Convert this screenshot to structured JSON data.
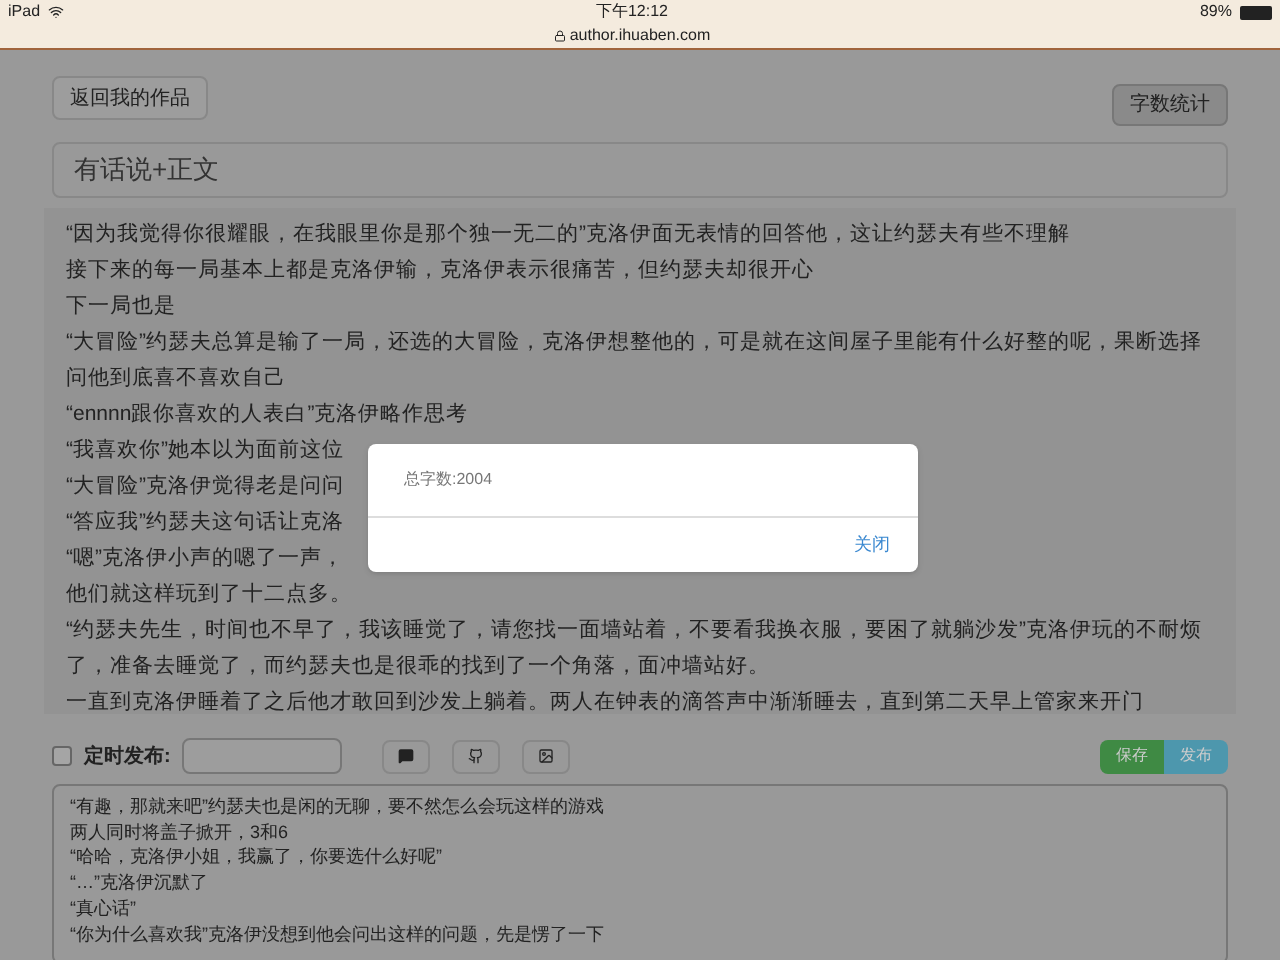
{
  "status_bar": {
    "device": "iPad",
    "time": "下午12:12",
    "url": "author.ihuaben.com",
    "battery": "89%"
  },
  "top_buttons": {
    "back": "返回我的作品",
    "count": "字数统计"
  },
  "title_field": {
    "value": "有话说+正文"
  },
  "content_lines": [
    "“因为我觉得你很耀眼，在我眼里你是那个独一无二的”克洛伊面无表情的回答他，这让约瑟夫有些不理解",
    "接下来的每一局基本上都是克洛伊输，克洛伊表示很痛苦，但约瑟夫却很开心",
    "下一局也是",
    "“大冒险”约瑟夫总算是输了一局，还选的大冒险，克洛伊想整他的，可是就在这间屋子里能有什么好整的呢，果断选择问他到底喜不喜欢自己",
    "“ennnn跟你喜欢的人表白”克洛伊略作思考",
    "“我喜欢你”她本以为面前这位",
    "“大冒险”克洛伊觉得老是问问",
    "“答应我”约瑟夫这句话让克洛",
    "“嗯”克洛伊小声的嗯了一声，",
    "他们就这样玩到了十二点多。",
    "“约瑟夫先生，时间也不早了，我该睡觉了，请您找一面墙站着，不要看我换衣服，要困了就躺沙发”克洛伊玩的不耐烦了，准备去睡觉了，而约瑟夫也是很乖的找到了一个角落，面冲墙站好。",
    "一直到克洛伊睡着了之后他才敢回到沙发上躺着。两人在钟表的滴答声中渐渐睡去，直到第二天早上管家来开门"
  ],
  "schedule": {
    "checked": false,
    "label": "定时发布:"
  },
  "actions": {
    "save": "保存",
    "publish": "发布"
  },
  "preview_lines": [
    "“有趣，那就来吧”约瑟夫也是闲的无聊，要不然怎么会玩这样的游戏",
    "两人同时将盖子掀开，3和6",
    "“哈哈，克洛伊小姐，我赢了，你要选什么好呢”",
    "“…”克洛伊沉默了",
    "“真心话”",
    "“你为什么喜欢我”克洛伊没想到他会问出这样的问题，先是愣了一下"
  ],
  "dialog": {
    "message": "总字数:2004",
    "close": "关闭"
  }
}
